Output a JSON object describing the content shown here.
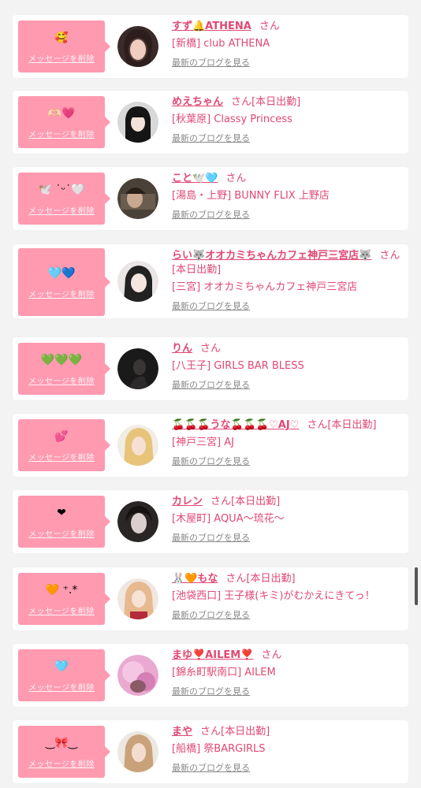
{
  "delete_label": "メッセージを削除",
  "blog_label": "最新のブログを見る",
  "honorific": "さん",
  "colors": {
    "accent": "#e04874",
    "bubble": "#ff9ab0",
    "background": "#f3f3f3"
  },
  "messages": [
    {
      "stamp": "🥰",
      "name": "すず🔔ATHENA",
      "status": "",
      "shop": "[新橋] club ATHENA"
    },
    {
      "stamp": "🫶🏻💗",
      "name": "めえちゃん",
      "status": "[本日出勤]",
      "shop": "[秋葉原] Classy Princess"
    },
    {
      "stamp": "🕊️ ˙ᵕ˙🤍",
      "name": "こと🕊️🩵",
      "status": "",
      "shop": "[湯島・上野] BUNNY FLIX 上野店"
    },
    {
      "stamp": "🩵💙",
      "name": "らい🐺オオカミちゃんカフェ神戸三宮店🐺",
      "status": "[本日出勤]",
      "shop": "[三宮] オオカミちゃんカフェ神戸三宮店"
    },
    {
      "stamp": "💚💚💚",
      "name": "りん",
      "status": "",
      "shop": "[八王子] GIRLS BAR BLESS"
    },
    {
      "stamp": "💕",
      "name": "🍒🍒🍒うな🍒🍒🍒♡AJ♡",
      "status": "[本日出勤]",
      "shop": "[神戸三宮] AJ"
    },
    {
      "stamp": "❤︎",
      "name": "カレン",
      "status": "[本日出勤]",
      "shop": "[木屋町] AQUA〜琉花〜"
    },
    {
      "stamp": "🧡 ⁺.*",
      "name": "🐰🧡もな",
      "status": "[本日出勤]",
      "shop": "[池袋西口] 王子様(キミ)がむかえにきてっ！"
    },
    {
      "stamp": "🩵",
      "name": "まゆ❣️AILEM❣️",
      "status": "",
      "shop": "[錦糸町駅南口] AILEM"
    },
    {
      "stamp": "‿🎀‿",
      "name": "まや",
      "status": "[本日出勤]",
      "shop": "[船橋] 祭BARGIRLS"
    }
  ]
}
